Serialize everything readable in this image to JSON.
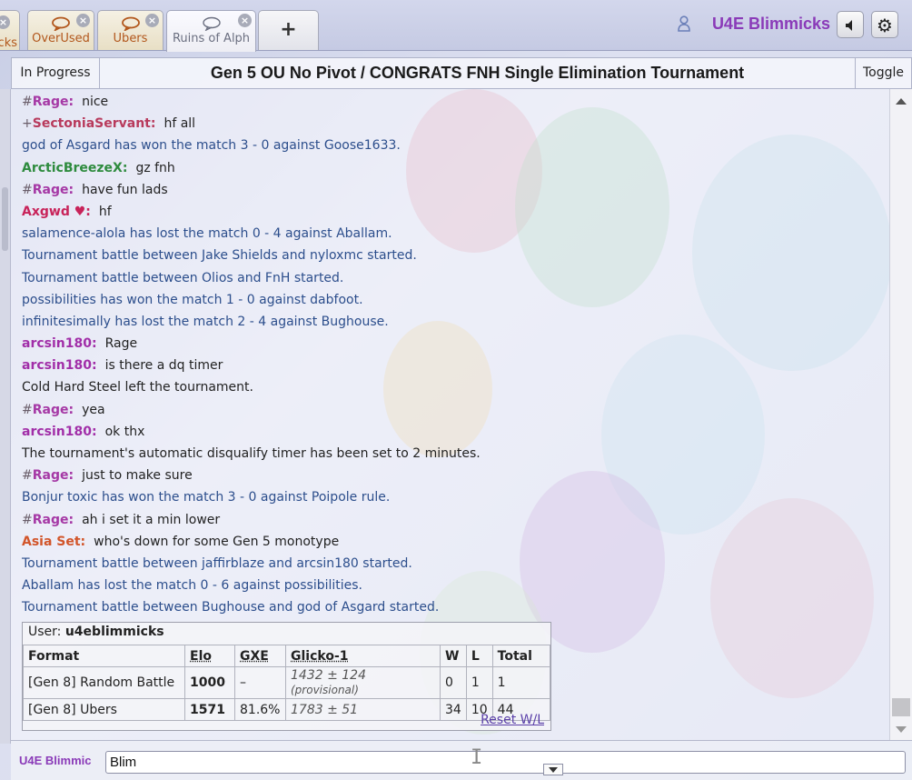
{
  "tabs": [
    {
      "label": "cks",
      "icon": "chat-bubble-icon"
    },
    {
      "label": "OverUsed",
      "icon": "chat-bubble-icon"
    },
    {
      "label": "Ubers",
      "icon": "chat-bubble-icon"
    },
    {
      "label": "Ruins of Alph",
      "icon": "chat-bubble-icon",
      "active": true
    }
  ],
  "new_tab_label": "+",
  "user": {
    "name": "U4E Blimmicks"
  },
  "header_buttons": {
    "sound": "🔈",
    "settings": "⚙"
  },
  "room": {
    "status": "In Progress",
    "title": "Gen 5 OU No Pivot / CONGRATS FNH Single Elimination Tournament",
    "toggle": "Toggle"
  },
  "messages": [
    {
      "type": "chat",
      "rank": "#",
      "user": "Rage:",
      "color": "#a538a5",
      "text": "nice"
    },
    {
      "type": "chat",
      "rank": "+",
      "user": "SectoniaServant:",
      "color": "#b83a5c",
      "text": "hf all"
    },
    {
      "type": "notice",
      "text": "god of Asgard has won the match 3 - 0 against Goose1633."
    },
    {
      "type": "chat",
      "rank": "",
      "user": "ArcticBreezeX:",
      "color": "#2e8b3e",
      "text": "gz fnh"
    },
    {
      "type": "chat",
      "rank": "#",
      "user": "Rage:",
      "color": "#a538a5",
      "text": "have fun lads"
    },
    {
      "type": "chat",
      "rank": "",
      "user": "Axgwd ♥:",
      "color": "#c8235a",
      "text": "hf"
    },
    {
      "type": "notice",
      "text": "salamence-alola has lost the match 0 - 4 against Aballam."
    },
    {
      "type": "notice",
      "text": "Tournament battle between Jake Shields and nyloxmc started."
    },
    {
      "type": "notice",
      "text": "Tournament battle between Olios and FnH started."
    },
    {
      "type": "notice",
      "text": "possibilities has won the match 1 - 0 against dabfoot."
    },
    {
      "type": "notice",
      "text": "infinitesimally has lost the match 2 - 4 against Bughouse."
    },
    {
      "type": "chat",
      "rank": "",
      "user": "arcsin180:",
      "color": "#a12ea8",
      "text": "Rage"
    },
    {
      "type": "chat",
      "rank": "",
      "user": "arcsin180:",
      "color": "#a12ea8",
      "text": "is there a dq timer"
    },
    {
      "type": "plain",
      "text": "Cold Hard Steel left the tournament."
    },
    {
      "type": "chat",
      "rank": "#",
      "user": "Rage:",
      "color": "#a538a5",
      "text": "yea"
    },
    {
      "type": "chat",
      "rank": "",
      "user": "arcsin180:",
      "color": "#a12ea8",
      "text": "ok thx"
    },
    {
      "type": "plain",
      "text": "The tournament's automatic disqualify timer has been set to 2 minutes."
    },
    {
      "type": "chat",
      "rank": "#",
      "user": "Rage:",
      "color": "#a538a5",
      "text": "just to make sure"
    },
    {
      "type": "notice",
      "text": "Bonjur toxic has won the match 3 - 0 against Poipole rule."
    },
    {
      "type": "chat",
      "rank": "#",
      "user": "Rage:",
      "color": "#a538a5",
      "text": "ah i set it a min lower"
    },
    {
      "type": "chat",
      "rank": "",
      "user": "Asia Set:",
      "color": "#d2552a",
      "text": "who's down for some Gen 5 monotype"
    },
    {
      "type": "notice",
      "text": "Tournament battle between jaffirblaze and arcsin180 started."
    },
    {
      "type": "notice",
      "text": "Aballam has lost the match 0 - 6 against possibilities."
    },
    {
      "type": "notice",
      "text": "Tournament battle between Bughouse and god of Asgard started."
    }
  ],
  "ranks": {
    "user_label": "User:",
    "user": "u4eblimmicks",
    "headers": [
      "Format",
      "Elo",
      "GXE",
      "Glicko-1",
      "W",
      "L",
      "Total"
    ],
    "rows": [
      {
        "format": "[Gen 8] Random Battle",
        "elo": "1000",
        "gxe": "–",
        "glicko": "1432 ± 124",
        "glicko_note": "(provisional)",
        "w": "0",
        "l": "1",
        "total": "1"
      },
      {
        "format": "[Gen 8] Ubers",
        "elo": "1571",
        "gxe": "81.6%",
        "glicko": "1783 ± 51",
        "glicko_note": "",
        "w": "34",
        "l": "10",
        "total": "44"
      }
    ],
    "reset_label": "Reset W/L"
  },
  "input": {
    "user_label": "U4E Blimmic",
    "value": "Blim"
  },
  "colors": {
    "notice": "#2c4e8c",
    "username": "#8a3ab8",
    "accent_tab": "#b2571c"
  }
}
